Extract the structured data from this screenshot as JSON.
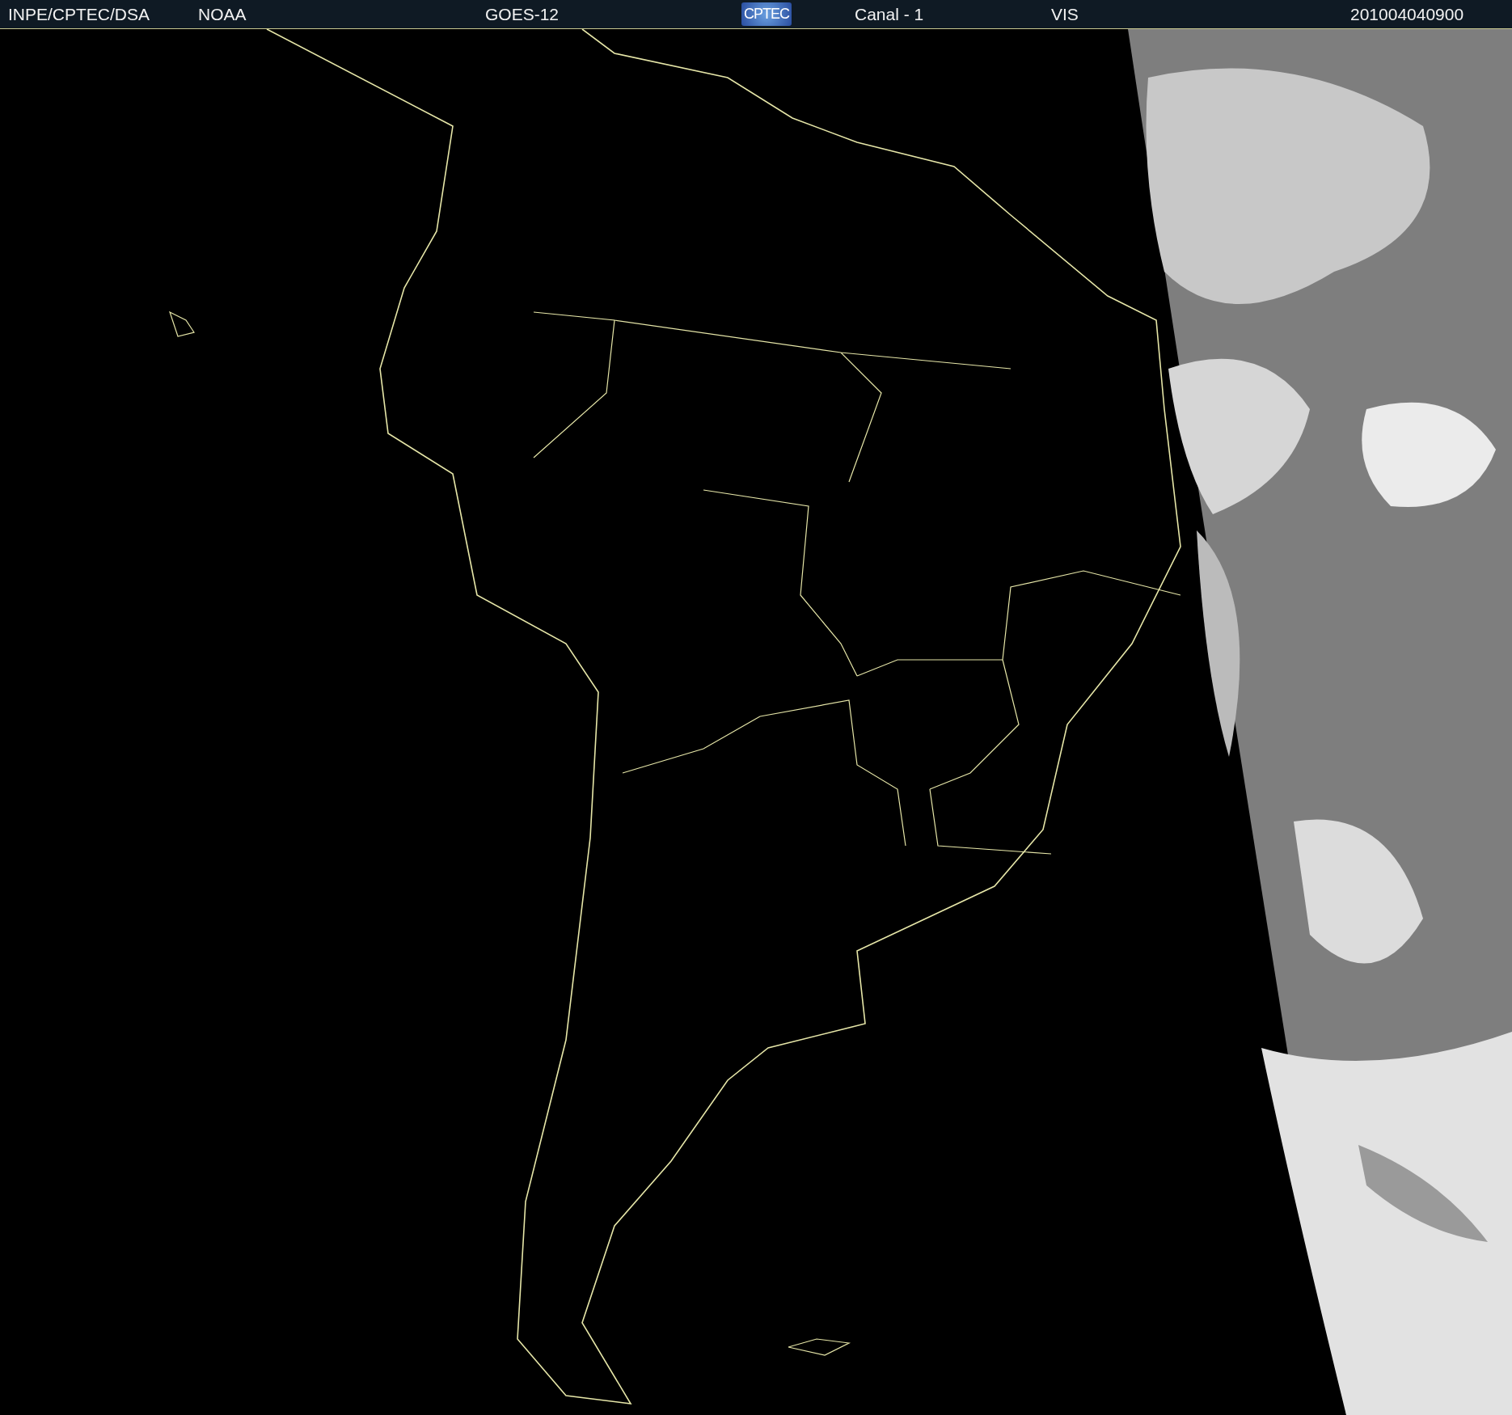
{
  "header": {
    "items": [
      {
        "kind": "text",
        "text": "INPE/CPTEC/DSA"
      },
      {
        "kind": "text",
        "text": "NOAA"
      },
      {
        "kind": "text",
        "text": "GOES-12"
      },
      {
        "kind": "logo",
        "text": "CPTEC"
      },
      {
        "kind": "text",
        "text": "Canal - 1"
      },
      {
        "kind": "text",
        "text": "VIS"
      },
      {
        "kind": "text",
        "text": "201004040900"
      }
    ]
  }
}
